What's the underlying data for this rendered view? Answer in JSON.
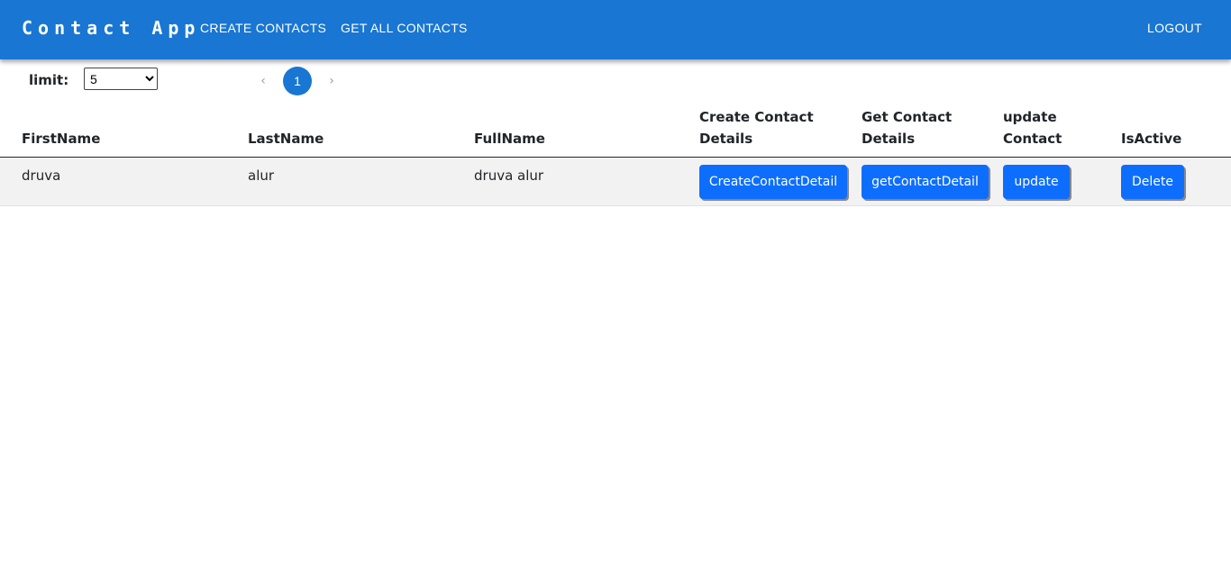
{
  "header": {
    "brand": "Contact App",
    "nav": {
      "create_contacts": "CREATE CONTACTS",
      "get_all_contacts": "GET ALL CONTACTS",
      "logout": "LOGOUT"
    }
  },
  "controls": {
    "limit_label": "limit:",
    "limit_value": "5",
    "limit_options": [
      "5"
    ],
    "pagination": {
      "prev": "‹",
      "current": "1",
      "next": "›"
    }
  },
  "table": {
    "columns": {
      "first_name": "FirstName",
      "last_name": "LastName",
      "full_name": "FullName",
      "create_details_1": "Create Contact",
      "create_details_2": "Details",
      "get_details_1": "Get Contact",
      "get_details_2": "Details",
      "update_1": "update",
      "update_2": "Contact",
      "is_active": "IsActive"
    },
    "rows": [
      {
        "first_name": "druva",
        "last_name": "alur",
        "full_name": "druva alur",
        "create_btn": "CreateContactDetail",
        "get_btn": "getContactDetail",
        "update_btn": "update",
        "delete_btn": "Delete"
      }
    ]
  },
  "colors": {
    "appbar": "#1976d2",
    "button": "#0d6efd",
    "row_bg": "#f2f2f2"
  }
}
